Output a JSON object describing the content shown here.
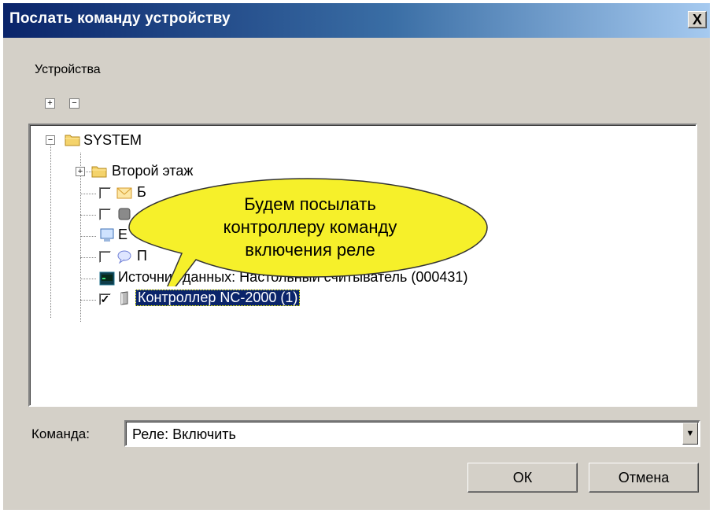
{
  "window": {
    "title": "Послать команду устройству",
    "close_glyph": "X"
  },
  "devices_label": "Устройства",
  "toolbar": {
    "expand_all": "+",
    "collapse_all": "−"
  },
  "tree": {
    "root": {
      "label": "SYSTEM",
      "icon": "folder-icon",
      "expanded": true
    },
    "items": [
      {
        "label": "Второй этаж",
        "icon": "folder-icon",
        "has_children": true,
        "checkbox": false
      },
      {
        "label": "Б",
        "icon": "mail-icon",
        "checkbox": true,
        "checked": false
      },
      {
        "label": "",
        "icon": "device-icon",
        "checkbox": true,
        "checked": false
      },
      {
        "label": "Е",
        "icon": "monitor-icon",
        "checkbox": false
      },
      {
        "label": "П",
        "icon": "speech-icon",
        "checkbox": true,
        "checked": false
      },
      {
        "label": "Источник данных: Настольный считыватель (000431)",
        "icon": "terminal-icon",
        "checkbox": false
      },
      {
        "label": "Контроллер NC-2000 (1)",
        "icon": "controller-icon",
        "checkbox": true,
        "checked": true,
        "selected": true
      }
    ]
  },
  "callout": {
    "lines": [
      "Будем посылать",
      "контроллеру команду",
      "включения реле"
    ],
    "fill": "#f6f02a"
  },
  "command": {
    "label": "Команда:",
    "value": "Реле: Включить"
  },
  "buttons": {
    "ok": "ОК",
    "cancel": "Отмена"
  },
  "colors": {
    "title_start": "#0a246a",
    "title_end": "#a6caf0",
    "face": "#d4d0c8",
    "selection": "#0a246a"
  }
}
